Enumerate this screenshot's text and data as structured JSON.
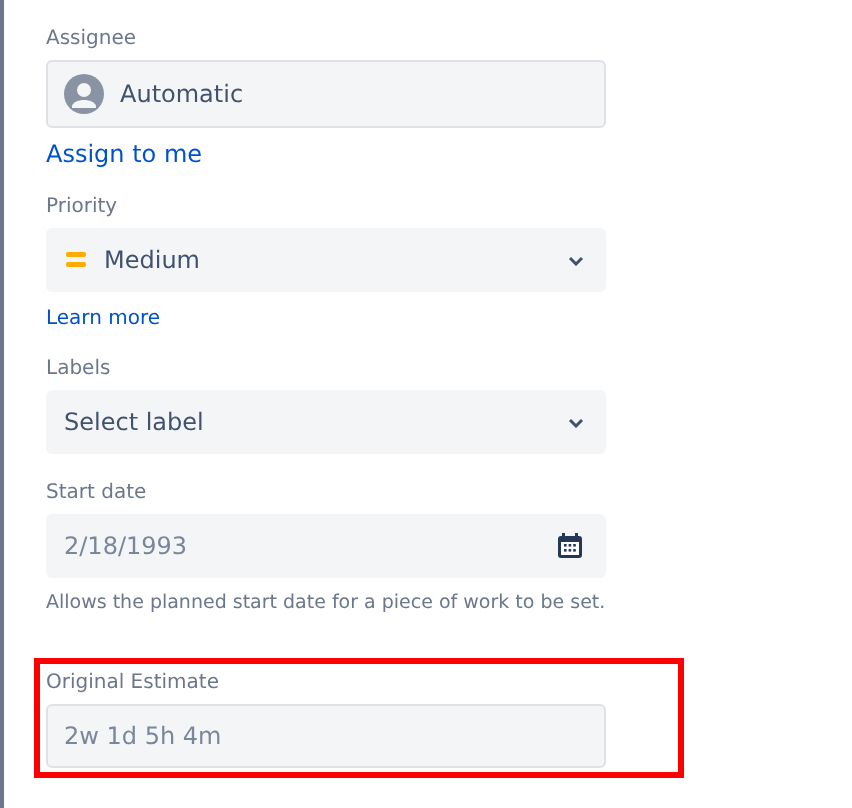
{
  "fields": [
    {
      "kind": "user",
      "label": "Assignee",
      "value": "Automatic",
      "link": "Assign to me",
      "highlighted": false
    },
    {
      "kind": "priority",
      "label": "Priority",
      "value": "Medium",
      "link": "Learn more",
      "highlighted": false
    },
    {
      "kind": "select",
      "label": "Labels",
      "placeholder": "Select label",
      "highlighted": false
    },
    {
      "kind": "date",
      "label": "Start date",
      "value": "2/18/1993",
      "help": "Allows the planned start date for a piece of work to be set.",
      "highlighted": false
    },
    {
      "kind": "text",
      "label": "Original Estimate",
      "value": "2w 1d 5h 4m",
      "highlighted": true
    }
  ]
}
